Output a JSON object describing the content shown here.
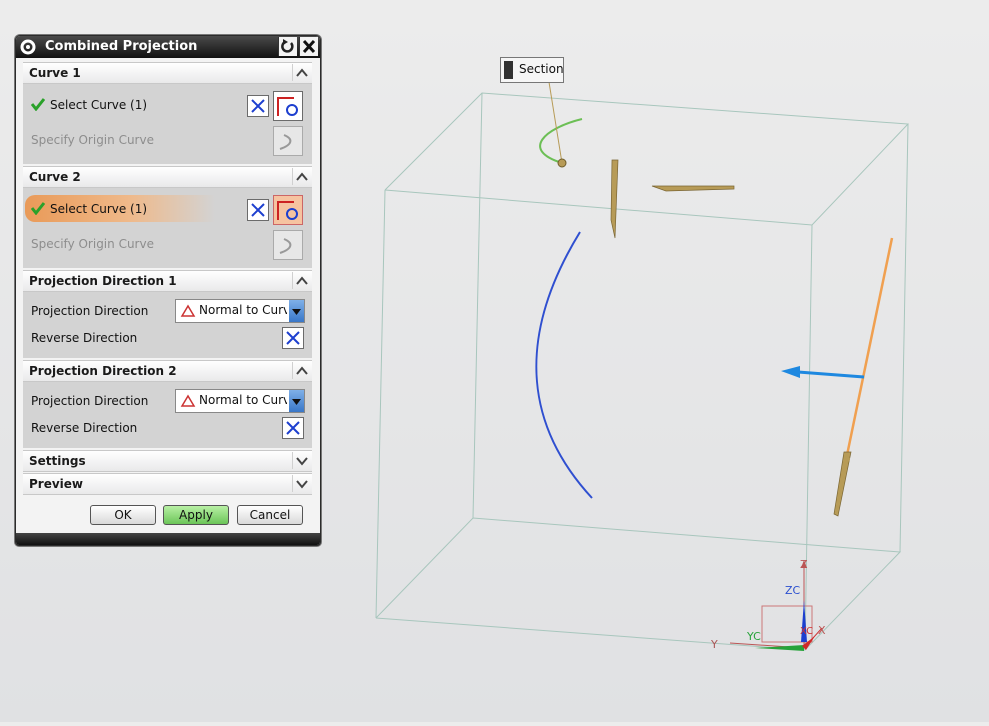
{
  "dialog": {
    "title": "Combined Projection",
    "sections": [
      {
        "title": "Curve 1",
        "select_label": "Select Curve (1)",
        "origin_label": "Specify Origin Curve"
      },
      {
        "title": "Curve 2",
        "select_label": "Select Curve (1)",
        "origin_label": "Specify Origin Curve"
      },
      {
        "title": "Projection Direction 1",
        "direction_label": "Projection Direction",
        "direction_value": "Normal to Curve",
        "reverse_label": "Reverse Direction"
      },
      {
        "title": "Projection Direction 2",
        "direction_label": "Projection Direction",
        "direction_value": "Normal to Curve",
        "reverse_label": "Reverse Direction"
      },
      {
        "title": "Settings"
      },
      {
        "title": "Preview"
      }
    ],
    "buttons": {
      "ok": "OK",
      "apply": "Apply",
      "cancel": "Cancel"
    }
  },
  "viewport": {
    "section_tag": "Section",
    "axis_labels": {
      "z": "Z",
      "zc": "ZC",
      "y": "Y",
      "yc": "YC",
      "x": "X",
      "xc": "XC"
    }
  },
  "colors": {
    "curve1": "#6cbf55",
    "curve_blue": "#2f4fd0",
    "curve_orange": "#f0a050",
    "arrow_tan": "#b79b57",
    "arrow_blue": "#1e88e0",
    "check": "#2aa12a",
    "highlight": "#e99a58"
  }
}
